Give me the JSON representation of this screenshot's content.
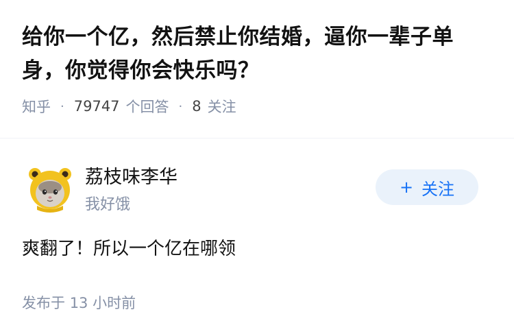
{
  "question": {
    "title": "给你一个亿，然后禁止你结婚，逼你一辈子单身，你觉得你会快乐吗？",
    "source": "知乎",
    "separator": "·",
    "answer_count": "79747",
    "answer_label": "个回答",
    "follow_count": "8",
    "follow_label": "关注"
  },
  "author": {
    "name": "荔枝味李华",
    "bio": "我好饿",
    "follow_plus": "+",
    "follow_label": "关注"
  },
  "answer": {
    "content": "爽翻了！所以一个亿在哪领",
    "time_prefix": "发布于",
    "time_value": "13 小时前"
  },
  "colors": {
    "accent": "#1772f6",
    "follow_bg": "#eaf2fb",
    "meta_text": "#8590a6",
    "avatar_ears": "#f2c21f"
  },
  "icons": {
    "avatar": "cat-in-yellow-bear-hood-avatar"
  }
}
